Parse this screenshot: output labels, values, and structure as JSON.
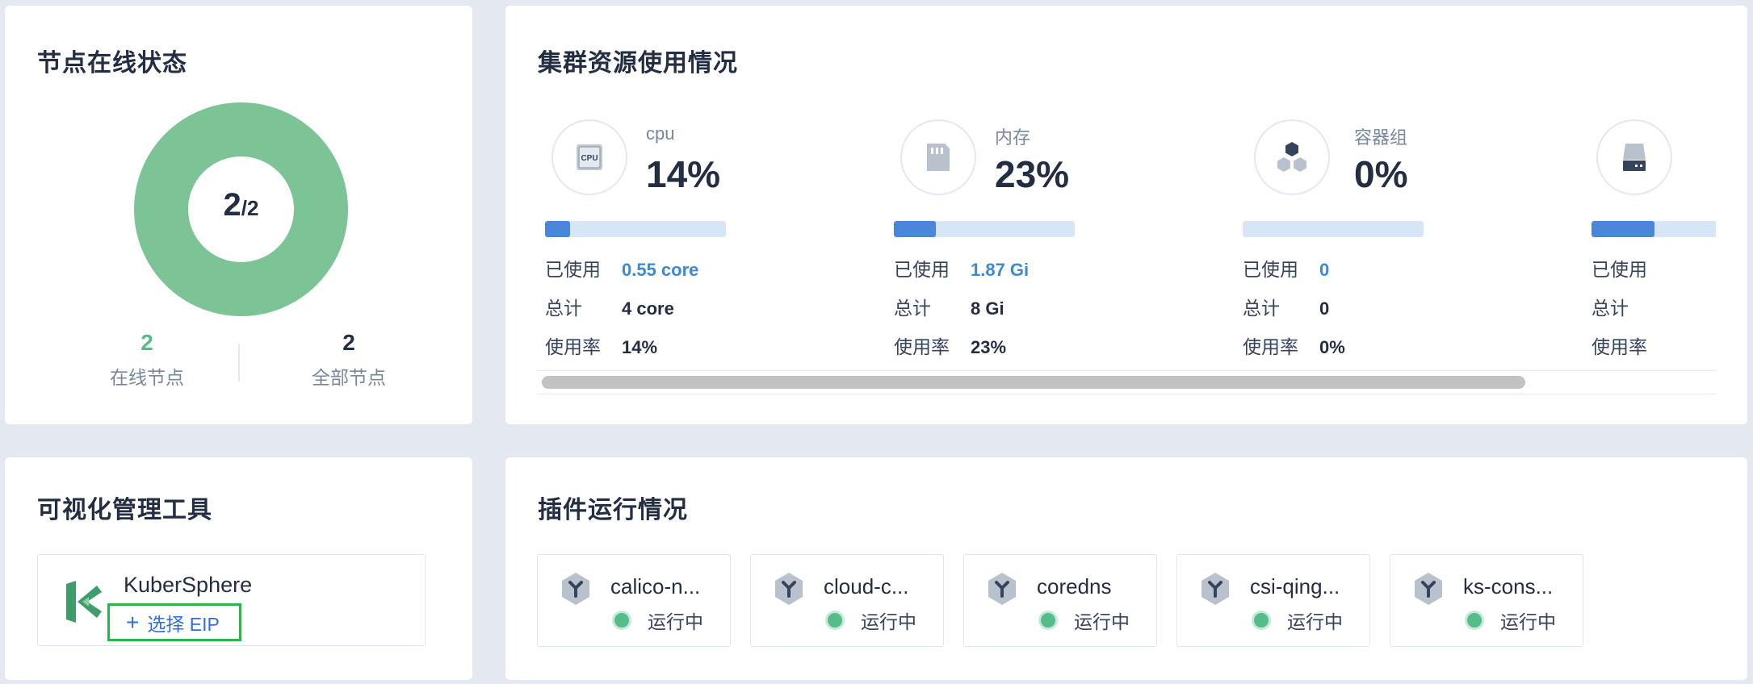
{
  "node_status": {
    "title": "节点在线状态",
    "online": "2",
    "total": "2",
    "total_fraction": "/2",
    "online_label": "在线节点",
    "total_label": "全部节点",
    "online_fraction": 1.0,
    "colors": {
      "donut": "#7cc496",
      "online_num": "#55bc8a"
    }
  },
  "resources": {
    "title": "集群资源使用情况",
    "items": [
      {
        "name": "cpu",
        "icon": "cpu-icon",
        "percent": "14%",
        "usage_fraction": 0.14,
        "used_label": "已使用",
        "used": "0.55 core",
        "total_label": "总计",
        "total": "4 core",
        "rate_label": "使用率",
        "rate": "14%"
      },
      {
        "name": "内存",
        "icon": "memory-card-icon",
        "percent": "23%",
        "usage_fraction": 0.23,
        "used_label": "已使用",
        "used": "1.87 Gi",
        "total_label": "总计",
        "total": "8 Gi",
        "rate_label": "使用率",
        "rate": "23%"
      },
      {
        "name": "容器组",
        "icon": "pods-icon",
        "percent": "0%",
        "usage_fraction": 0.0,
        "used_label": "已使用",
        "used": "0",
        "total_label": "总计",
        "total": "0",
        "rate_label": "使用率",
        "rate": "0%"
      },
      {
        "name": "",
        "icon": "disk-icon",
        "percent": "",
        "usage_fraction": 0.35,
        "used_label": "已使用",
        "used": "",
        "total_label": "总计",
        "total": "",
        "rate_label": "使用率",
        "rate": ""
      }
    ]
  },
  "tools": {
    "title": "可视化管理工具",
    "app_name": "KuberSphere",
    "eip_button": "选择 EIP",
    "plus": "+",
    "logo_icon": "kubesphere-logo-icon"
  },
  "plugins": {
    "title": "插件运行情况",
    "items": [
      {
        "name": "calico-n...",
        "status": "运行中"
      },
      {
        "name": "cloud-c...",
        "status": "运行中"
      },
      {
        "name": "coredns",
        "status": "运行中"
      },
      {
        "name": "csi-qing...",
        "status": "运行中"
      },
      {
        "name": "ks-cons...",
        "status": "运行中"
      }
    ],
    "icon": "plugin-hex-icon",
    "status_color": "#55bc8a"
  }
}
